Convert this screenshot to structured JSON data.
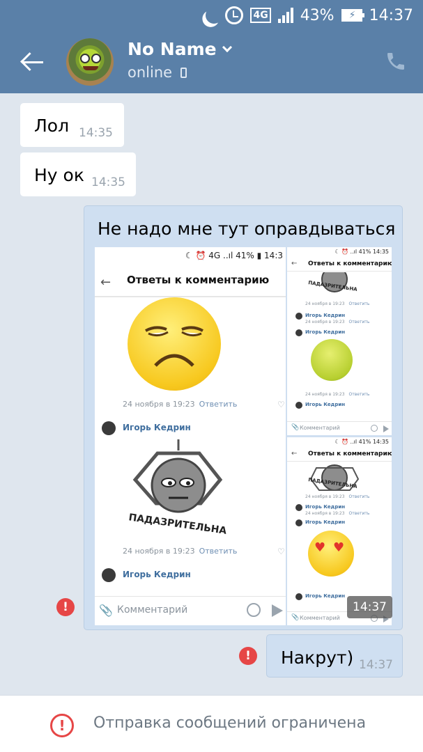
{
  "status_bar": {
    "network": "4G",
    "battery_percent": "43%",
    "time": "14:37",
    "icons": [
      "moon-icon",
      "alarm-icon",
      "signal-icon",
      "battery-charging-icon"
    ]
  },
  "header": {
    "contact_name": "No Name",
    "status": "online",
    "icons": [
      "back-arrow-icon",
      "chevron-down-icon",
      "mobile-icon",
      "phone-icon"
    ]
  },
  "messages": [
    {
      "direction": "in",
      "text": "Лол",
      "time": "14:35"
    },
    {
      "direction": "in",
      "text": "Ну ок",
      "time": "14:35"
    },
    {
      "direction": "out",
      "text": "Не надо мне тут оправдываться",
      "time": "14:37",
      "error": "!",
      "has_attachment": true
    },
    {
      "direction": "out",
      "text": "Накрут)",
      "time": "14:37",
      "error": "!"
    }
  ],
  "attachment": {
    "main": {
      "status": "41%",
      "status_time": "14:3",
      "title": "Ответы к комментарию",
      "date": "24 ноября в 19:23",
      "reply": "Ответить",
      "author": "Игорь Кедрин",
      "sticker_text": "ПАДАЗРИТЕЛЬНА",
      "comment_placeholder": "Комментарий"
    },
    "small": {
      "status_time": "14:35",
      "status": "41%",
      "title": "Ответы к комментарию",
      "date": "24 ноября в 19:23",
      "reply": "Ответить",
      "author": "Игорь Кедрин",
      "sticker_text": "ПАДАЗРИТЕЛЬНА",
      "comment_placeholder": "Комментарий"
    }
  },
  "footer": {
    "icon": "!",
    "text": "Отправка сообщений ограничена"
  },
  "colors": {
    "header": "#5a80a8",
    "chat_background": "#dfe6ee",
    "outgoing_bubble": "#cfdff1",
    "incoming_bubble": "#ffffff",
    "error": "#e64646"
  }
}
